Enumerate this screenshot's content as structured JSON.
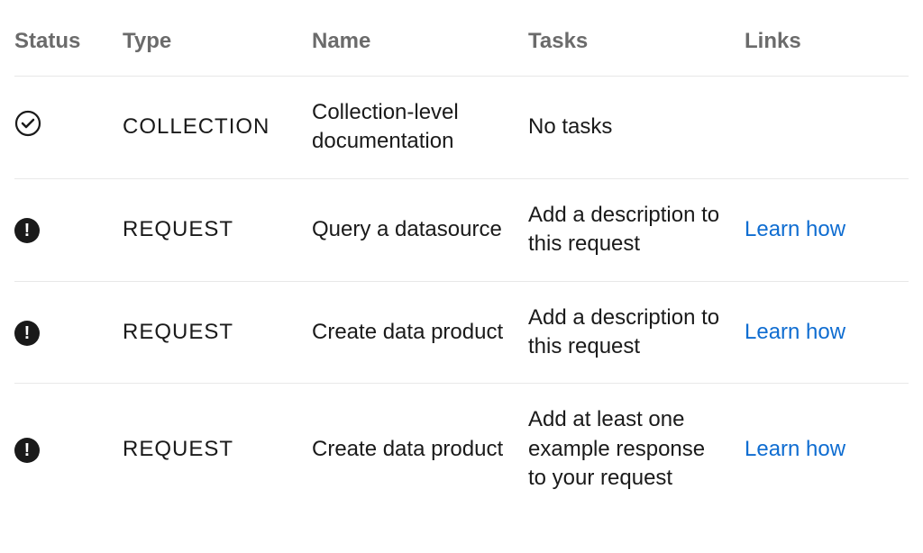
{
  "headers": {
    "status": "Status",
    "type": "Type",
    "name": "Name",
    "tasks": "Tasks",
    "links": "Links"
  },
  "rows": [
    {
      "status": "complete",
      "type": "COLLECTION",
      "name": "Collection-level documentation",
      "tasks": "No tasks",
      "link": ""
    },
    {
      "status": "warning",
      "type": "REQUEST",
      "name": "Query a datasource",
      "tasks": "Add a description to this request",
      "link": "Learn how"
    },
    {
      "status": "warning",
      "type": "REQUEST",
      "name": "Create data product",
      "tasks": "Add a description to this request",
      "link": "Learn how"
    },
    {
      "status": "warning",
      "type": "REQUEST",
      "name": "Create data product",
      "tasks": "Add at least one example response to your request",
      "link": "Learn how"
    }
  ]
}
